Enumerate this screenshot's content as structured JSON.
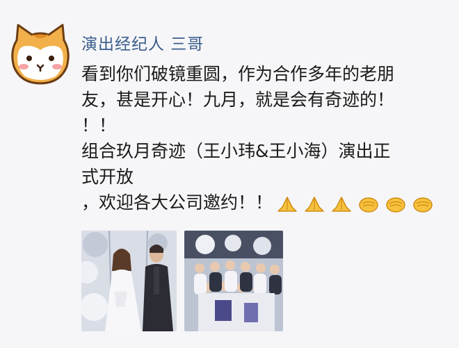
{
  "post": {
    "author": "演出经纪人  三哥",
    "lines": [
      "看到你们破镜重圆，作为合作多年的老朋",
      "友，甚是开心！九月，就是会有奇迹的！",
      "！！",
      "组合玖月奇迹（王小玮&王小海）演出正",
      "式开放",
      "，欢迎各大公司邀约！！"
    ],
    "emojis": [
      "praying-hands-icon",
      "praying-hands-icon",
      "praying-hands-icon",
      "fist-salute-icon",
      "fist-salute-icon",
      "fist-salute-icon"
    ]
  },
  "colors": {
    "author": "#3a5d8c",
    "text": "#1a1a1a",
    "background": "#f6f6f8",
    "avatar_fur": "#f2b04a"
  }
}
